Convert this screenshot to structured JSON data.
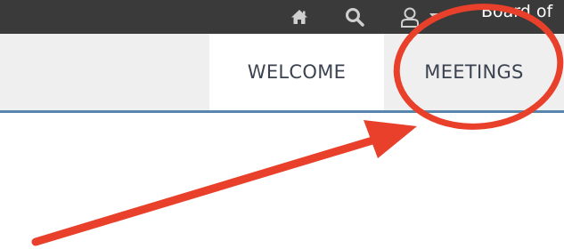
{
  "topbar": {
    "icons": [
      "home-icon",
      "search-icon",
      "user-icon",
      "caret-down-icon"
    ],
    "org_title": "Board of"
  },
  "nav": {
    "tabs": [
      {
        "label": "WELCOME"
      },
      {
        "label": "MEETINGS"
      }
    ]
  },
  "colors": {
    "topbar_bg": "#3a3a3a",
    "nav_bg": "#efefef",
    "active_tab_bg": "#ffffff",
    "nav_border": "#5a86ad",
    "annotation_red": "#e8402a"
  }
}
